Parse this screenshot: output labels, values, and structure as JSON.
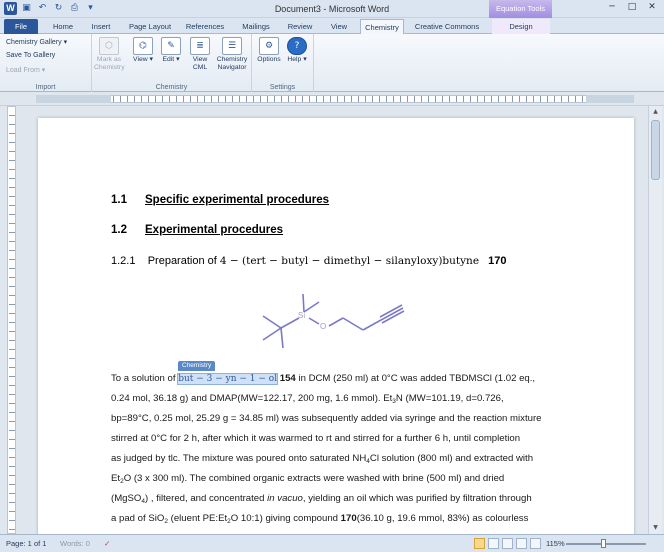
{
  "window": {
    "title": "Document3 - Microsoft Word",
    "context_group": "Equation Tools"
  },
  "tabs": [
    "File",
    "Home",
    "Insert",
    "Page Layout",
    "References",
    "Mailings",
    "Review",
    "View",
    "Chemistry",
    "Creative Commons",
    "Design"
  ],
  "ribbon": {
    "import": {
      "label": "Import",
      "gallery": "Chemistry Gallery",
      "save_gallery": "Save To Gallery",
      "load_from": "Load From"
    },
    "chemistry": {
      "label": "Chemistry",
      "mark_as": "Mark as Chemistry",
      "view": "View",
      "edit": "Edit",
      "view_cml": "View CML",
      "navigator": "Chemistry Navigator"
    },
    "settings": {
      "label": "Settings",
      "options": "Options",
      "help": "Help"
    }
  },
  "document": {
    "h1a_num": "1.1",
    "h1a_text": "Specific experimental procedures",
    "h1b_num": "1.2",
    "h1b_text": "Experimental procedures",
    "h3_num": "1.2.1",
    "h3_text": "Preparation of",
    "h3_name": "4 − (tert − butyl − dimethyl − silanyloxy)butyne",
    "h3_compound": "170",
    "chem_tag": "Chemistry",
    "p1_pre": "To a solution of",
    "p1_highlight": "but − 3 − yn − 1 − ol",
    "p1_compound": "154",
    "p1_post": "in DCM (250 ml) at 0°C was added TBDMSCl (1.02 eq.,",
    "p2": "0.24 mol, 36.18 g) and DMAP(MW=122.17, 200 mg, 1.6 mmol). Et",
    "p2_sub": "3",
    "p2b": "N (MW=101.19, d=0.726,",
    "p3": "bp=89°C, 0.25 mol, 25.29 g = 34.85 ml) was subsequently added via syringe and the reaction mixture",
    "p4": "stirred at 0°C for 2 h, after which it was warmed to rt and stirred for a further 6 h, until completion",
    "p5": "as judged by tlc. The mixture was poured onto saturated NH",
    "p5_sub": "4",
    "p5b": "Cl solution (800 ml) and extracted with",
    "p6": "Et",
    "p6_sub": "2",
    "p6b": "O (3 x 300 ml). The combined organic extracts were washed with brine (500 ml) and dried",
    "p7": "(MgSO",
    "p7_sub": "4",
    "p7b": ") , filtered, and concentrated",
    "p7_em": "in vacuo",
    "p7c": ", yielding an oil which was purified by filtration through",
    "p8": "a pad of SiO",
    "p8_sub": "2",
    "p8b": " (eluent PE:Et",
    "p8_sub2": "2",
    "p8c": "O 10:1) giving compound",
    "p8_compound": "170",
    "p8d": "(36.10 g, 19.6 mmol, 83%) as colourless"
  },
  "status": {
    "page": "Page: 1 of 1",
    "words": "Words: 0",
    "zoom": "115%"
  }
}
